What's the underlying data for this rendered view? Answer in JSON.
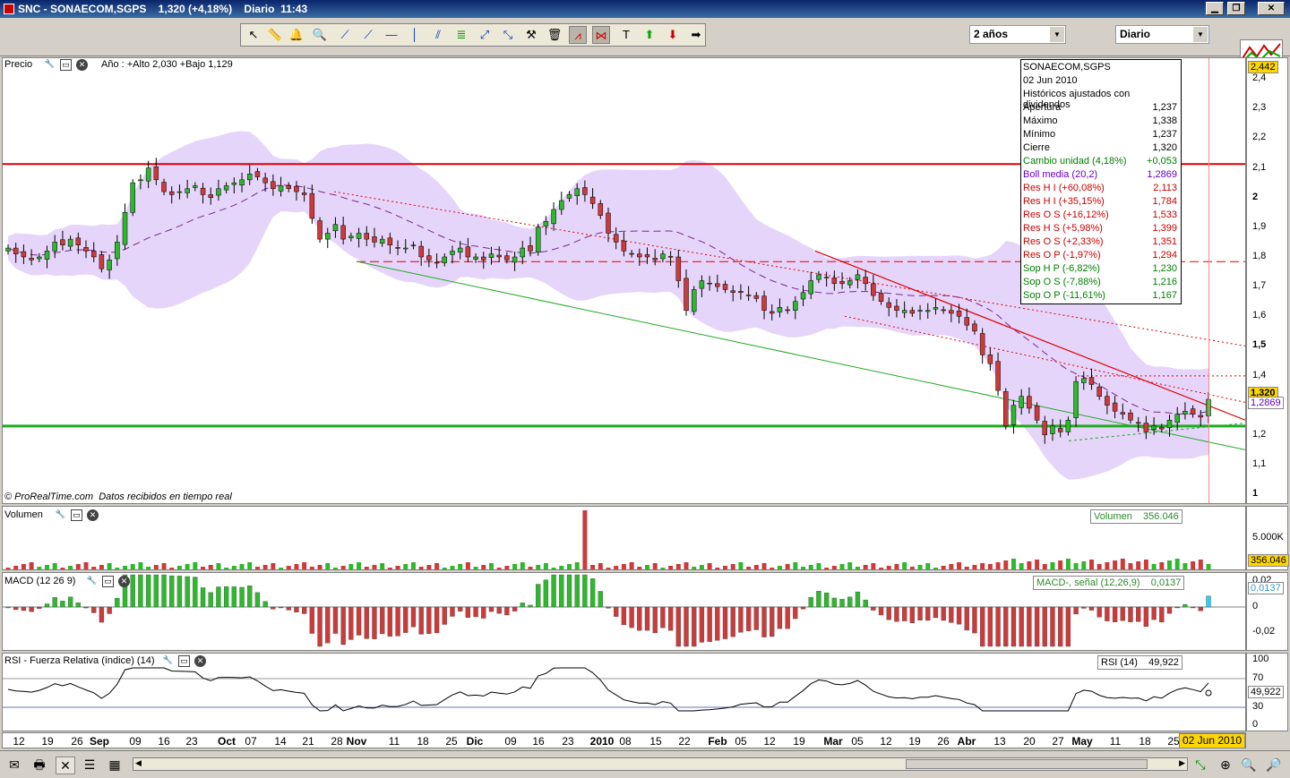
{
  "window": {
    "title": "SNC - SONAECOM,SGPS    1,320 (+4,18%)    Diario  11:43"
  },
  "toolbar": {
    "period_select": "2 años",
    "interval_select": "Diario"
  },
  "price_panel": {
    "label": "Precio",
    "header_info": "Año : +Alto 2,030 +Bajo 1,129",
    "footer": "© ProRealTime.com  Datos recibidos en tiempo real",
    "y_ticks": [
      "2,4",
      "2,3",
      "2,2",
      "2,1",
      "2",
      "1,9",
      "1,8",
      "1,7",
      "1,6",
      "1,5",
      "1,4",
      "1,3",
      "1,2",
      "1,1",
      "1"
    ],
    "top_tag": "2,442",
    "close_tag": "1,320",
    "boll_tag": "1,2869"
  },
  "info_box": {
    "name": "SONAECOM,SGPS",
    "date": "02 Jun 2010",
    "note": "Históricos ajustados con dividendos",
    "rows": [
      {
        "k": "Apertura",
        "v": "1,237",
        "c": "#000000"
      },
      {
        "k": "Máximo",
        "v": "1,338",
        "c": "#000000"
      },
      {
        "k": "Mínimo",
        "v": "1,237",
        "c": "#000000"
      },
      {
        "k": "Cierre",
        "v": "1,320",
        "c": "#000000"
      },
      {
        "k": "Cambio unidad (4,18%)",
        "v": "+0,053",
        "c": "#008000"
      },
      {
        "k": "Boll media (20,2)",
        "v": "1,2869",
        "c": "#6600cc"
      },
      {
        "k": "Res H I (+60,08%)",
        "v": "2,113",
        "c": "#cc0000"
      },
      {
        "k": "Res H I (+35,15%)",
        "v": "1,784",
        "c": "#cc0000"
      },
      {
        "k": "Res O S (+16,12%)",
        "v": "1,533",
        "c": "#cc0000"
      },
      {
        "k": "Res H S (+5,98%)",
        "v": "1,399",
        "c": "#cc0000"
      },
      {
        "k": "Res O S (+2,33%)",
        "v": "1,351",
        "c": "#cc0000"
      },
      {
        "k": "Res O P (-1,97%)",
        "v": "1,294",
        "c": "#cc0000"
      },
      {
        "k": "Sop H P (-6,82%)",
        "v": "1,230",
        "c": "#008000"
      },
      {
        "k": "Sop O S (-7,88%)",
        "v": "1,216",
        "c": "#008000"
      },
      {
        "k": "Sop O P (-11,61%)",
        "v": "1,167",
        "c": "#008000"
      }
    ]
  },
  "volume_panel": {
    "label": "Volumen",
    "legend": "Volumen    356.046",
    "tick": "5.000K",
    "tag": "356.046"
  },
  "macd_panel": {
    "label": "MACD (12 26 9)",
    "legend": "MACD-, señal (12,26,9)    0,0137",
    "ticks": [
      "0,02",
      "0",
      "-0,02"
    ],
    "tag": "0,0137"
  },
  "rsi_panel": {
    "label": "RSI - Fuerza Relativa (índice) (14)",
    "legend": "RSI (14)    49,922",
    "ticks": [
      "100",
      "70",
      "30",
      "0"
    ],
    "tag": "49,922"
  },
  "x_axis": {
    "labels": [
      {
        "t": "12",
        "x": 18,
        "b": false
      },
      {
        "t": "19",
        "x": 50,
        "b": false
      },
      {
        "t": "26",
        "x": 83,
        "b": false
      },
      {
        "t": "Sep",
        "x": 108,
        "b": true
      },
      {
        "t": "09",
        "x": 148,
        "b": false
      },
      {
        "t": "16",
        "x": 180,
        "b": false
      },
      {
        "t": "23",
        "x": 211,
        "b": false
      },
      {
        "t": "Oct",
        "x": 250,
        "b": true
      },
      {
        "t": "07",
        "x": 277,
        "b": false
      },
      {
        "t": "14",
        "x": 310,
        "b": false
      },
      {
        "t": "21",
        "x": 341,
        "b": false
      },
      {
        "t": "28",
        "x": 373,
        "b": false
      },
      {
        "t": "Nov",
        "x": 395,
        "b": true
      },
      {
        "t": "11",
        "x": 437,
        "b": false
      },
      {
        "t": "18",
        "x": 469,
        "b": false
      },
      {
        "t": "25",
        "x": 501,
        "b": false
      },
      {
        "t": "Dic",
        "x": 527,
        "b": true
      },
      {
        "t": "09",
        "x": 567,
        "b": false
      },
      {
        "t": "16",
        "x": 598,
        "b": false
      },
      {
        "t": "23",
        "x": 631,
        "b": false
      },
      {
        "t": "2010",
        "x": 669,
        "b": true
      },
      {
        "t": "08",
        "x": 695,
        "b": false
      },
      {
        "t": "15",
        "x": 729,
        "b": false
      },
      {
        "t": "22",
        "x": 761,
        "b": false
      },
      {
        "t": "Feb",
        "x": 798,
        "b": true
      },
      {
        "t": "05",
        "x": 824,
        "b": false
      },
      {
        "t": "12",
        "x": 856,
        "b": false
      },
      {
        "t": "19",
        "x": 889,
        "b": false
      },
      {
        "t": "Mar",
        "x": 927,
        "b": true
      },
      {
        "t": "05",
        "x": 954,
        "b": false
      },
      {
        "t": "12",
        "x": 986,
        "b": false
      },
      {
        "t": "19",
        "x": 1018,
        "b": false
      },
      {
        "t": "26",
        "x": 1050,
        "b": false
      },
      {
        "t": "Abr",
        "x": 1076,
        "b": true
      },
      {
        "t": "13",
        "x": 1113,
        "b": false
      },
      {
        "t": "20",
        "x": 1146,
        "b": false
      },
      {
        "t": "27",
        "x": 1178,
        "b": false
      },
      {
        "t": "May",
        "x": 1205,
        "b": true
      },
      {
        "t": "11",
        "x": 1242,
        "b": false
      },
      {
        "t": "18",
        "x": 1275,
        "b": false
      },
      {
        "t": "25",
        "x": 1307,
        "b": false
      }
    ],
    "current_date": "02 Jun 2010"
  },
  "colors": {
    "bull": "#2db82d",
    "bear": "#cc3b3b",
    "band": "#e6d5fb",
    "resistance": "#dd0000",
    "support": "#22aa22",
    "cursor": "#ff6666"
  },
  "chart_data": {
    "type": "candlestick",
    "close_series": [
      1.83,
      1.81,
      1.8,
      1.79,
      1.8,
      1.82,
      1.85,
      1.84,
      1.86,
      1.84,
      1.82,
      1.8,
      1.76,
      1.79,
      1.85,
      1.95,
      2.05,
      2.06,
      2.1,
      2.06,
      2.02,
      2.01,
      2.02,
      2.03,
      2.04,
      2.01,
      2.0,
      2.03,
      2.04,
      2.05,
      2.06,
      2.08,
      2.07,
      2.05,
      2.03,
      2.04,
      2.03,
      2.02,
      2.01,
      1.93,
      1.86,
      1.88,
      1.91,
      1.86,
      1.87,
      1.88,
      1.86,
      1.85,
      1.86,
      1.84,
      1.83,
      1.83,
      1.84,
      1.8,
      1.79,
      1.78,
      1.8,
      1.82,
      1.83,
      1.8,
      1.8,
      1.79,
      1.81,
      1.8,
      1.79,
      1.8,
      1.83,
      1.82,
      1.9,
      1.92,
      1.96,
      1.99,
      2.01,
      2.03,
      2.01,
      1.98,
      1.94,
      1.88,
      1.85,
      1.82,
      1.81,
      1.8,
      1.8,
      1.79,
      1.81,
      1.8,
      1.72,
      1.62,
      1.69,
      1.72,
      1.71,
      1.7,
      1.69,
      1.68,
      1.68,
      1.67,
      1.66,
      1.62,
      1.61,
      1.63,
      1.62,
      1.65,
      1.68,
      1.72,
      1.74,
      1.73,
      1.71,
      1.71,
      1.72,
      1.74,
      1.71,
      1.67,
      1.65,
      1.63,
      1.62,
      1.62,
      1.61,
      1.62,
      1.62,
      1.63,
      1.62,
      1.61,
      1.6,
      1.57,
      1.55,
      1.47,
      1.44,
      1.35,
      1.23,
      1.3,
      1.33,
      1.29,
      1.25,
      1.2,
      1.23,
      1.21,
      1.25,
      1.38,
      1.39,
      1.37,
      1.33,
      1.3,
      1.28,
      1.27,
      1.25,
      1.24,
      1.21,
      1.23,
      1.22,
      1.25,
      1.27,
      1.28,
      1.27,
      1.26,
      1.32
    ],
    "y_range": [
      0.97,
      2.47
    ],
    "volume_spike_index": 74,
    "price_levels": {
      "resistance_high": 2.113,
      "resistance": 1.784,
      "support": 1.23
    }
  }
}
